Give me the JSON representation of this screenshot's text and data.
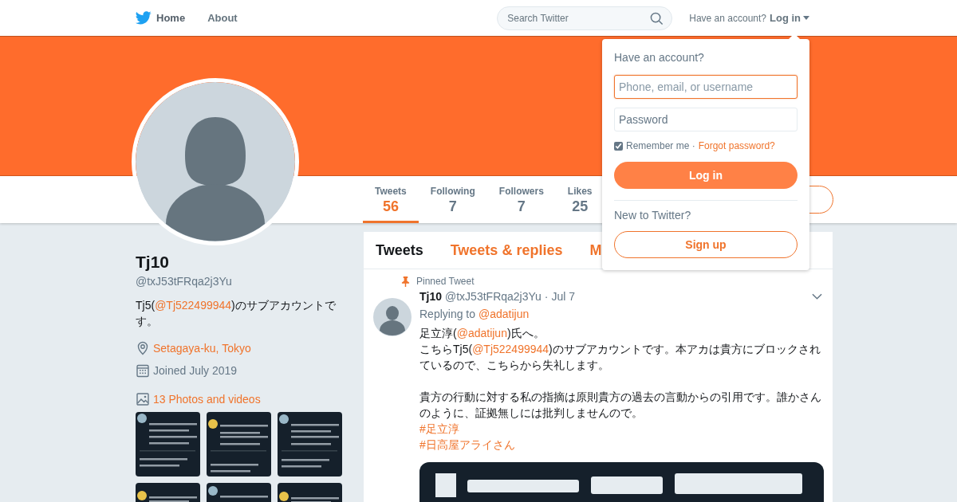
{
  "nav": {
    "items": [
      {
        "label": "Home",
        "selected": true
      },
      {
        "label": "About",
        "selected": false
      }
    ],
    "search": {
      "placeholder": "Search Twitter"
    },
    "account_prompt": "Have an account?",
    "login_link": "Log in"
  },
  "profile": {
    "name": "Tj10",
    "handle": "@txJ53tFRqa2j3Yu",
    "bio": [
      {
        "kind": "text",
        "text": "Tj5("
      },
      {
        "kind": "mention",
        "text": "@Tj522499944"
      },
      {
        "kind": "text",
        "text": ")のサブアカウントです。"
      }
    ],
    "location": "Setagaya-ku, Tokyo",
    "joined": "Joined July 2019",
    "photos_link": "13 Photos and videos",
    "photos": [
      {
        "kind": "picture"
      },
      {
        "kind": "picture"
      },
      {
        "kind": "picture"
      },
      {
        "kind": "picture"
      },
      {
        "kind": "picture"
      },
      {
        "kind": "picture"
      }
    ]
  },
  "stats": [
    {
      "label": "Tweets",
      "value": "56",
      "selected": true
    },
    {
      "label": "Following",
      "value": "7",
      "selected": false
    },
    {
      "label": "Followers",
      "value": "7",
      "selected": false
    },
    {
      "label": "Likes",
      "value": "25",
      "selected": false
    }
  ],
  "timeline_tabs": [
    {
      "label": "Tweets",
      "selected": true
    },
    {
      "label": "Tweets & replies",
      "selected": false
    },
    {
      "label": "M",
      "selected": false
    }
  ],
  "tweet": {
    "pinned_label": "Pinned Tweet",
    "name": "Tj10",
    "handle": "@txJ53tFRqa2j3Yu",
    "date": "· Jul 7",
    "reply_prefix": "Replying to",
    "reply_to": "@adatijun",
    "paragraphs": [
      [
        [
          {
            "kind": "text",
            "text": "足立淳("
          },
          {
            "kind": "mention",
            "text": "@adatijun"
          },
          {
            "kind": "text",
            "text": ")氏へ。"
          }
        ],
        [
          {
            "kind": "text",
            "text": "こちらTj5("
          },
          {
            "kind": "mention",
            "text": "@Tj522499944"
          },
          {
            "kind": "text",
            "text": ")のサブアカウントです。本アカは貴方にブロックされているので、こちらから失礼します。"
          }
        ]
      ],
      [
        [
          {
            "kind": "text",
            "text": "貴方の行動に対する私の指摘は原則貴方の過去の言動からの引用です。誰かさんのように、証拠無しには批判しませんので。"
          }
        ],
        [
          {
            "kind": "hashtag",
            "text": "#足立淳"
          }
        ],
        [
          {
            "kind": "hashtag",
            "text": "#日高屋アライさん"
          }
        ]
      ]
    ],
    "media": {
      "kind": "picture"
    }
  },
  "login_menu": {
    "title": "Have an account?",
    "fields": [
      {
        "placeholder": "Phone, email, or username",
        "focused": true
      },
      {
        "placeholder": "Password",
        "focused": false
      }
    ],
    "remember_me": {
      "label": "Remember me ·",
      "checked": true
    },
    "forgot": "Forgot password?",
    "login_button": "Log in",
    "new_prompt": "New to Twitter?",
    "signup_button": "Sign up"
  }
}
